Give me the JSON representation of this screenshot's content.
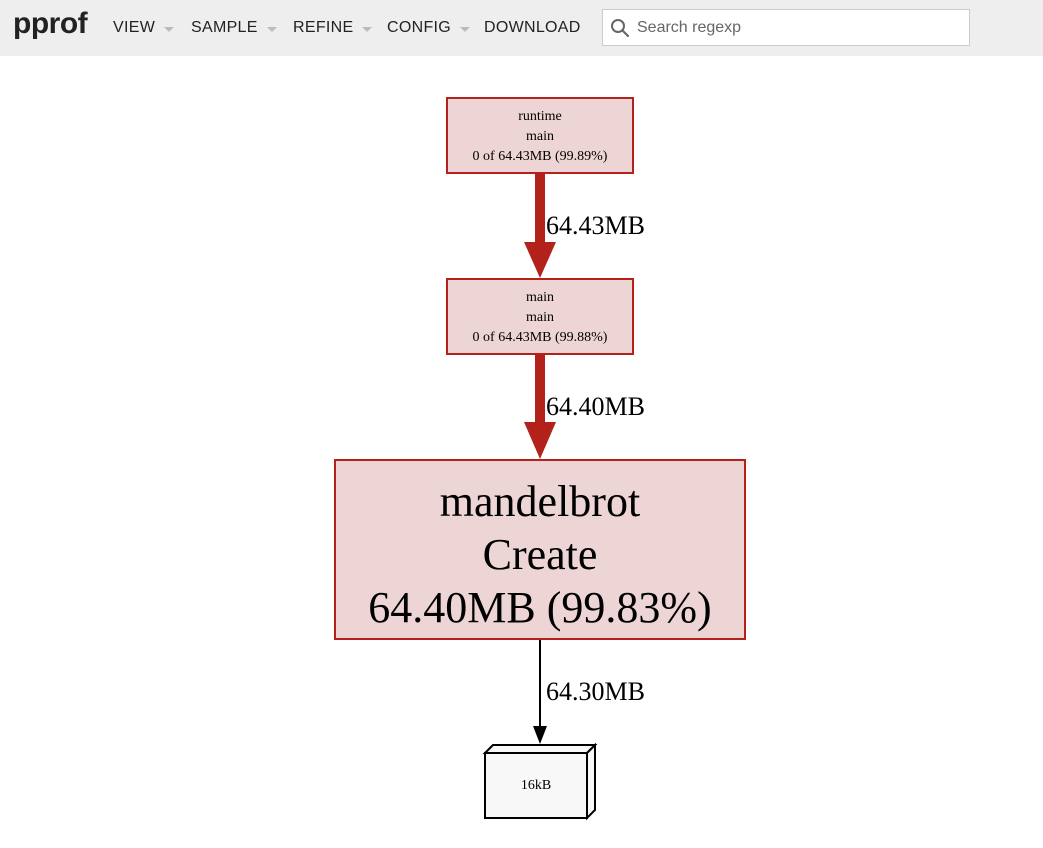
{
  "app": {
    "logo": "pprof"
  },
  "menu": {
    "view": "VIEW",
    "sample": "SAMPLE",
    "refine": "REFINE",
    "config": "CONFIG",
    "download": "DOWNLOAD"
  },
  "search": {
    "placeholder": "Search regexp",
    "value": ""
  },
  "graph": {
    "nodes": [
      {
        "line1": "runtime",
        "line2": "main",
        "line3": "0 of 64.43MB (99.89%)"
      },
      {
        "line1": "main",
        "line2": "main",
        "line3": "0 of 64.43MB (99.88%)"
      },
      {
        "line1": "mandelbrot",
        "line2": "Create",
        "line3": "64.40MB (99.83%)"
      }
    ],
    "leaf": {
      "label": "16kB"
    },
    "edges": [
      {
        "label": "64.43MB"
      },
      {
        "label": "64.40MB"
      },
      {
        "label": "64.30MB"
      }
    ]
  },
  "colors": {
    "hot_node_fill": "#edd5d5",
    "hot_edge": "#b2221b",
    "toolbar_bg": "#eeeeee",
    "leaf_fill": "#f8f8f8"
  }
}
